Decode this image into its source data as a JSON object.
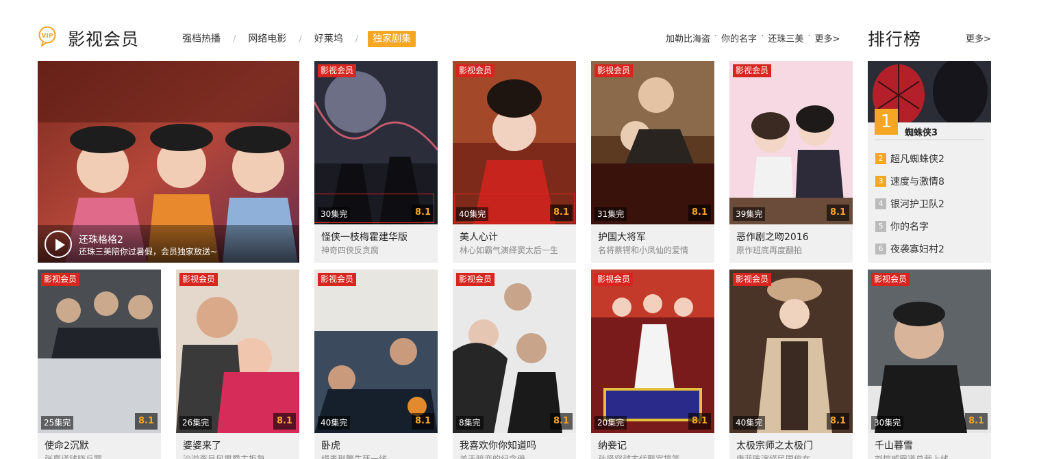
{
  "header": {
    "title": "影视会员",
    "vip_logo_text": "VIP",
    "tabs": [
      {
        "label": "强档热播"
      },
      {
        "label": "网络电影"
      },
      {
        "label": "好莱坞"
      },
      {
        "label": "独家剧集"
      }
    ],
    "hot_links": [
      "加勒比海盗",
      "你的名字",
      "还珠三美"
    ],
    "more_label": "更多>"
  },
  "ranking": {
    "title": "排行榜",
    "more_label": "更多>",
    "top": {
      "rank": "1",
      "name": "蜘蛛侠3"
    },
    "items": [
      {
        "rank": "2",
        "name": "超凡蜘蛛侠2"
      },
      {
        "rank": "3",
        "name": "速度与激情8"
      },
      {
        "rank": "4",
        "name": "银河护卫队2"
      },
      {
        "rank": "5",
        "name": "你的名字"
      },
      {
        "rank": "6",
        "name": "夜袭寡妇村2"
      }
    ]
  },
  "feature": {
    "title": "还珠格格2",
    "subtitle": "还珠三美陪你过暑假，会员独家放送~"
  },
  "badge_label": "影视会员",
  "row1": [
    {
      "title": "怪侠一枝梅霍建华版",
      "sub": "神奇四侠反贪腐",
      "eps": "30集完",
      "score": "8.1"
    },
    {
      "title": "美人心计",
      "sub": "林心如霸气演绎窦太后一生",
      "eps": "40集完",
      "score": "8.1"
    },
    {
      "title": "护国大将军",
      "sub": "名将蔡锷和小凤仙的爱情",
      "eps": "31集完",
      "score": "8.1"
    },
    {
      "title": "恶作剧之吻2016",
      "sub": "原作班底再度翻拍",
      "eps": "39集完",
      "score": "8.1"
    }
  ],
  "row2": [
    {
      "title": "使命2沉默",
      "sub": "张嘉译钱晓丘罪",
      "eps": "25集完",
      "score": "8.1"
    },
    {
      "title": "婆婆来了",
      "sub": "沙溢李呈风男爵主拒复",
      "eps": "26集完",
      "score": "8.1"
    },
    {
      "title": "卧虎",
      "sub": "缉毒刑警生死一线",
      "eps": "40集完",
      "score": "8.1"
    },
    {
      "title": "我喜欢你你知道吗",
      "sub": "关于暗恋的纪念册",
      "eps": "8集完",
      "score": "8.1"
    },
    {
      "title": "纳妾记",
      "sub": "孙坚穿越古代娶宰搞笑",
      "eps": "20集完",
      "score": "8.1"
    },
    {
      "title": "太极宗师之太极门",
      "sub": "唐菲陈演绎民国侠女",
      "eps": "40集完",
      "score": "8.1"
    },
    {
      "title": "千山暮雪",
      "sub": "刘恺威霸道总裁上线",
      "eps": "30集完",
      "score": "8.1"
    }
  ]
}
